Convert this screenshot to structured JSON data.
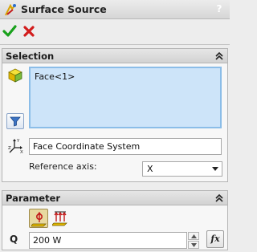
{
  "window": {
    "title": "Surface Source",
    "help_label": "?",
    "icons": {
      "logo": "surface-source-icon",
      "help": "help-icon"
    },
    "colors": {
      "ok": "#19a11c",
      "cancel": "#d21d1d",
      "selection_box": "#cde4f9"
    }
  },
  "actions": {
    "ok_icon": "green-check-icon",
    "cancel_icon": "red-x-icon"
  },
  "selection": {
    "header": "Selection",
    "items": [
      "Face<1>"
    ],
    "coordinate_system": "Face Coordinate System",
    "reference_axis_label": "Reference axis:",
    "reference_axis_value": "X",
    "icons": {
      "face": "face-cube-icon",
      "filter": "filter-icon",
      "coordinate_system": "coordinate-axes-icon",
      "collapse": "double-chevron-up-icon"
    }
  },
  "parameter": {
    "header": "Parameter",
    "quantity_label": "Q",
    "value": "200 W",
    "fx_label": "fx",
    "direction_options": [
      "per-face-icon",
      "distributed-icon"
    ],
    "selected_direction": "per-face-icon"
  }
}
